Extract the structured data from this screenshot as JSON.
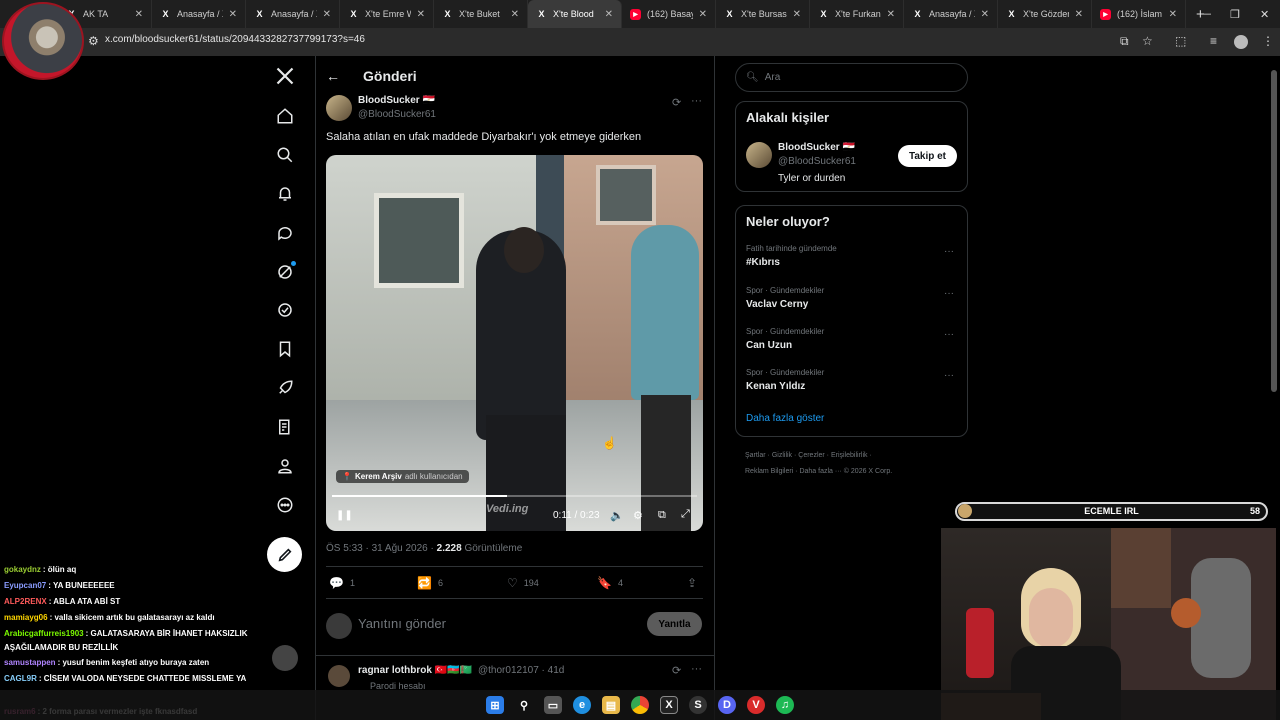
{
  "browser": {
    "tabs": [
      {
        "label": "AK TA",
        "icon": "x-logo-icon"
      },
      {
        "label": "Anasayfa / X",
        "icon": "x-logo-icon"
      },
      {
        "label": "Anasayfa / X",
        "icon": "x-logo-icon"
      },
      {
        "label": "X'te Emre W",
        "icon": "x-logo-icon"
      },
      {
        "label": "X'te Buket",
        "icon": "x-logo-icon"
      },
      {
        "label": "X'te Blood",
        "icon": "x-logo-icon",
        "active": true
      },
      {
        "label": "(162) Basay",
        "icon": "youtube-icon"
      },
      {
        "label": "X'te Bursasp",
        "icon": "x-logo-icon"
      },
      {
        "label": "X'te Furkan",
        "icon": "x-logo-icon"
      },
      {
        "label": "Anasayfa / X",
        "icon": "x-logo-icon"
      },
      {
        "label": "X'te Gözden",
        "icon": "x-logo-icon"
      },
      {
        "label": "(162) İslam",
        "icon": "youtube-icon"
      }
    ],
    "url": "x.com/bloodsucker61/status/2094433282737799173?s=46"
  },
  "post": {
    "header_title": "Gönderi",
    "author_name": "BloodSucker 🇪🇬",
    "author_handle": "@BloodSucker61",
    "text": "Salaha atılan en ufak maddede Diyarbakır'ı yok etmeye giderken",
    "video_tag_name": "Kerem Arşiv",
    "video_tag_suffix": "adlı kullanıcıdan",
    "video_time": "0:11 / 0:23",
    "video_progress": 0.48,
    "watermark": "Vedi.ing",
    "time": "ÖS 5:33 · 31 Ağu 2026 ·",
    "views_count": "2.228",
    "views_label": "Görüntüleme",
    "replies": "1",
    "reposts": "6",
    "likes": "194",
    "bookmarks": "4",
    "reply_placeholder": "Yanıtını gönder",
    "reply_button": "Yanıtla"
  },
  "next_reply": {
    "name": "ragnar lothbrok 🇹🇷🇦🇿🇹🇲",
    "handle": "@thor012107 · 41d",
    "sub": "Parodi hesabı"
  },
  "sidebar": {
    "search_placeholder": "Ara",
    "people_title": "Alakalı kişiler",
    "person_name": "BloodSucker 🇪🇬",
    "person_handle": "@BloodSucker61",
    "person_bio": "Tyler or durden",
    "follow_button": "Takip et",
    "trends_title": "Neler oluyor?",
    "trends": [
      {
        "meta": "Fatih tarihinde gündemde",
        "name": "#Kıbrıs"
      },
      {
        "meta": "Spor · Gündemdekiler",
        "name": "Vaclav Cerny"
      },
      {
        "meta": "Spor · Gündemdekiler",
        "name": "Can Uzun"
      },
      {
        "meta": "Spor · Gündemdekiler",
        "name": "Kenan Yıldız"
      }
    ],
    "show_more": "Daha fazla göster",
    "footer_line1": "Şartlar  ·  Gizlilik  ·  Çerezler  ·  Erişilebilirlik  ·",
    "footer_line2": "Reklam Bilgileri  ·  Daha fazla ···  © 2026 X Corp."
  },
  "stream": {
    "bar_label": "ECEMLE IRL",
    "bar_count": "58"
  },
  "chat": [
    {
      "user": "gokaydnz",
      "msg": ": ölün aq",
      "color": "#9acd32"
    },
    {
      "user": "Eyupcan07",
      "msg": ": YA BUNEEEEEE",
      "color": "#8a9cff"
    },
    {
      "user": "ALP2RENX",
      "msg": ": ABLA ATA ABİ ST",
      "color": "#ff5a5a"
    },
    {
      "user": "mamiayg06",
      "msg": ": valla sikicem artık bu galatasarayı az kaldı",
      "color": "#ffd700"
    },
    {
      "user": "Arabicgaffurreis1903",
      "msg": ": GALATASARAYA BİR İHANET HAKSIZLIK",
      "color": "#7cfc00"
    },
    {
      "user": "",
      "msg": "AŞAĞILAMADIR BU REZİLLİK",
      "color": "#ffffff"
    },
    {
      "user": "samustappen",
      "msg": ": yusuf benim keşfeti atıyo buraya zaten",
      "color": "#b084ff"
    },
    {
      "user": "CAGL9R",
      "msg": ": CİSEM VALODA NEYSEDE CHATTEDE MISSLEME YA",
      "color": "#87cefa"
    },
    {
      "user": "rusram6",
      "msg": ": 2 forma parası vermezler işte fknasdfasd",
      "color": "#ff69b4"
    }
  ]
}
